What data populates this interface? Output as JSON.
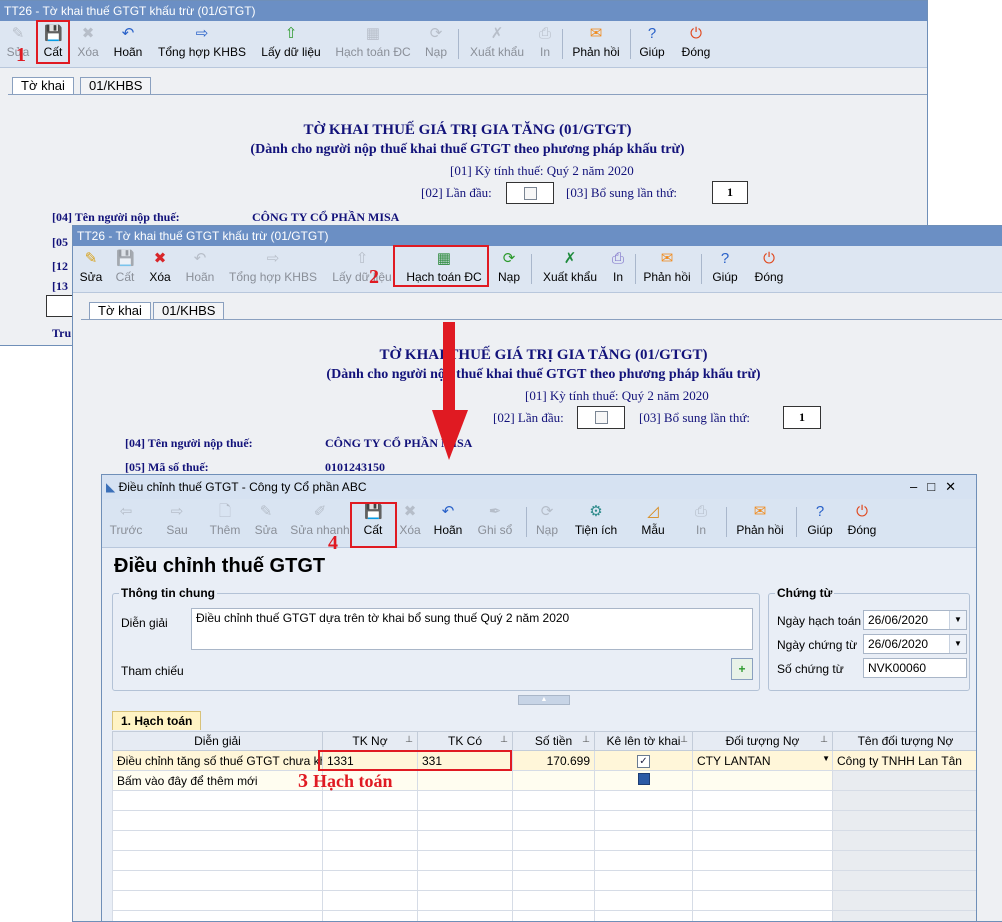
{
  "win1": {
    "title": "TT26 - Tờ khai thuế GTGT khấu trừ (01/GTGT)",
    "toolbar": [
      "Sửa",
      "Cất",
      "Xóa",
      "Hoãn",
      "Tổng hợp KHBS",
      "Lấy dữ liệu",
      "Hạch toán ĐC",
      "Nạp",
      "Xuất khẩu",
      "In",
      "Phản hồi",
      "Giúp",
      "Đóng"
    ],
    "tabs": [
      "Tờ khai",
      "01/KHBS"
    ],
    "heading": "TỜ KHAI THUẾ GIÁ TRỊ GIA TĂNG (01/GTGT)",
    "subheading": "(Dành cho người nộp thuế khai thuế GTGT theo phương pháp khấu trừ)",
    "period_label": "[01] Kỳ tính thuế:",
    "period_value": "Quý 2 năm 2020",
    "first_label": "[02] Lần đầu:",
    "supp_label": "[03] Bổ sung lần thứ:",
    "supp_value": "1",
    "taxpayer_label": "[04] Tên người nộp thuế:",
    "taxpayer_value": "CÔNG TY CỔ PHẦN MISA",
    "row05": "[05",
    "row12": "[12",
    "row13": "[13",
    "truncated": "Tru"
  },
  "win2": {
    "title": "TT26 - Tờ khai thuế GTGT khấu trừ (01/GTGT)",
    "toolbar": [
      "Sửa",
      "Cất",
      "Xóa",
      "Hoãn",
      "Tổng hợp KHBS",
      "Lấy dữ liệu",
      "Hạch toán ĐC",
      "Nạp",
      "Xuất khẩu",
      "In",
      "Phản hồi",
      "Giúp",
      "Đóng"
    ],
    "tabs": [
      "Tờ khai",
      "01/KHBS"
    ],
    "heading": "TỜ KHAI THUẾ GIÁ TRỊ GIA TĂNG (01/GTGT)",
    "subheading": "(Dành cho người nộp thuế khai thuế GTGT theo phương pháp khấu trừ)",
    "period_label": "[01] Kỳ tính thuế:",
    "period_value": "Quý 2 năm 2020",
    "first_label": "[02] Lần đầu:",
    "supp_label": "[03] Bổ sung lần thứ:",
    "supp_value": "1",
    "taxpayer_label": "[04] Tên người nộp thuế:",
    "taxpayer_value": "CÔNG TY CỔ PHẦN MISA",
    "taxcode_label": "[05] Mã số thuế:",
    "taxcode_value": "0101243150"
  },
  "dialog": {
    "title": "Điều chỉnh thuế GTGT - Công ty Cổ phần ABC",
    "toolbar": [
      "Trước",
      "Sau",
      "Thêm",
      "Sửa",
      "Sửa nhanh",
      "Cất",
      "Xóa",
      "Hoãn",
      "Ghi sổ",
      "Nạp",
      "Tiện ích",
      "Mẫu",
      "In",
      "Phản hồi",
      "Giúp",
      "Đóng"
    ],
    "heading": "Điều chỉnh thuế GTGT",
    "general_title": "Thông tin chung",
    "desc_label": "Diễn giải",
    "desc_value": "Điều chỉnh thuế GTGT dựa trên tờ khai bổ sung thuế Quý 2 năm 2020",
    "ref_label": "Tham chiếu",
    "voucher_title": "Chứng từ",
    "posting_date_label": "Ngày hạch toán",
    "posting_date": "26/06/2020",
    "voucher_date_label": "Ngày chứng từ",
    "voucher_date": "26/06/2020",
    "voucher_no_label": "Số chứng từ",
    "voucher_no": "NVK00060",
    "tab_label": "1. Hạch toán",
    "columns": [
      "Diễn giải",
      "TK Nợ",
      "TK Có",
      "Số tiền",
      "Kê lên tờ khai",
      "Đối tượng Nợ",
      "Tên đối tượng Nợ"
    ],
    "row": {
      "desc": "Điều chỉnh tăng số thuế GTGT chưa kh",
      "debit": "1331",
      "credit": "331",
      "amount": "170.699",
      "obj": "CTY LANTAN",
      "obj_name": "Công ty TNHH Lan Tân"
    },
    "add_row": "Bấm vào đây để thêm mới"
  },
  "annotations": {
    "n1": "1",
    "n2": "2",
    "n3": "3",
    "n3_text": "Hạch toán",
    "n4": "4"
  },
  "colors": {
    "annotation": "#e01a22",
    "navy": "#12127a",
    "titlebar": "#6b8fc4"
  }
}
